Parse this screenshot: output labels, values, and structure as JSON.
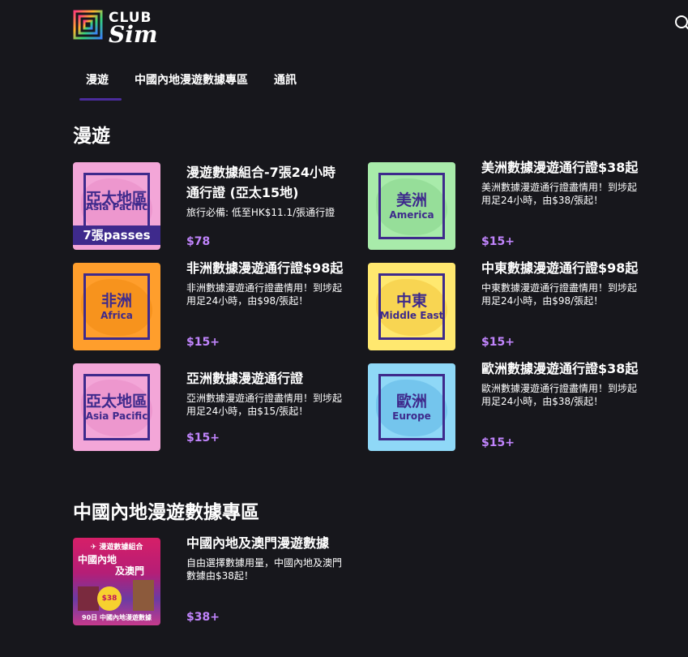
{
  "header": {
    "logo_club": "CLUB",
    "logo_sim": "Sim",
    "search_icon": "search-icon"
  },
  "tabs": [
    {
      "label": "漫遊",
      "active": true
    },
    {
      "label": "中國內地漫遊數據專區",
      "active": false
    },
    {
      "label": "通訊",
      "active": false
    }
  ],
  "sections": {
    "roaming_title": "漫遊",
    "china_title": "中國內地漫遊數據專區"
  },
  "cards": [
    {
      "thumb_cn": "亞太地區",
      "thumb_en": "Asia Pacific",
      "thumb_passes": "7張passes",
      "thumb_color": "#f3a6d8",
      "title": "漫遊數據組合-7張24小時通行證 (亞太15地)",
      "desc": "旅行必備: 低至HK$11.1/張通行證",
      "price": "$78"
    },
    {
      "thumb_cn": "美洲",
      "thumb_en": "America",
      "thumb_color": "#a8ebaa",
      "title": "美洲數據漫遊通行證$38起",
      "desc": "美洲數據漫遊通行證盡情用！到埗起用足24小時，由$38/張起！",
      "price": "$15+"
    },
    {
      "thumb_cn": "非洲",
      "thumb_en": "Africa",
      "thumb_color": "#ff9e2c",
      "title": "非洲數據漫遊通行證$98起",
      "desc": "非洲數據漫遊通行證盡情用！到埗起用足24小時，由$98/張起！",
      "price": "$15+"
    },
    {
      "thumb_cn": "中東",
      "thumb_en": "Middle East",
      "thumb_color": "#ffe86f",
      "title": "中東數據漫遊通行證$98起",
      "desc": "中東數據漫遊通行證盡情用！到埗起用足24小時，由$98/張起！",
      "price": "$15+"
    },
    {
      "thumb_cn": "亞太地區",
      "thumb_en": "Asia Pacific",
      "thumb_color": "#f3a6d8",
      "title": "亞洲數據漫遊通行證",
      "desc": "亞洲數據漫遊通行證盡情用！到埗起用足24小時，由$15/張起！",
      "price": "$15+"
    },
    {
      "thumb_cn": "歐洲",
      "thumb_en": "Europe",
      "thumb_color": "#8fd8f7",
      "title": "歐洲數據漫遊通行證$38起",
      "desc": "歐洲數據漫遊通行證盡情用！到埗起用足24小時，由$38/張起！",
      "price": "$15+"
    }
  ],
  "china_card": {
    "promo_top": "✈ 漫遊數據組合",
    "promo_title_1": "中國內地",
    "promo_title_2": "及澳門",
    "promo_badge": "$38",
    "promo_foot": "90日 中國內地漫遊數據",
    "title": "中國內地及澳門漫遊數據",
    "desc": "自由選擇數據用量，中國內地及澳門數據由$38起！",
    "price": "$38+"
  },
  "colors": {
    "background": "#17171c",
    "accent": "#4b2c9c",
    "price": "#c084fc",
    "thumb_ink": "#3e2a8c"
  }
}
